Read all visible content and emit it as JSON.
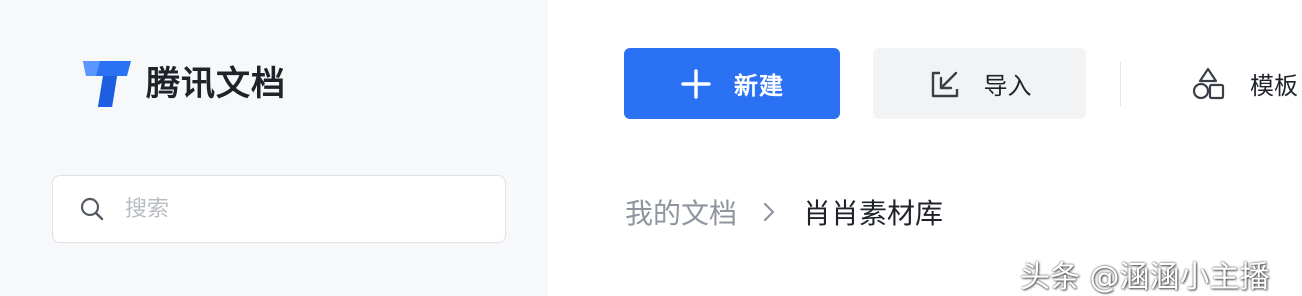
{
  "sidebar": {
    "logo": {
      "icon": "tencent-docs-logo-icon",
      "text": "腾讯文档"
    },
    "search": {
      "placeholder": "搜索",
      "value": "",
      "icon": "search-icon"
    }
  },
  "toolbar": {
    "new_button": {
      "label": "新建",
      "icon": "plus-icon"
    },
    "import_button": {
      "label": "导入",
      "icon": "import-icon"
    },
    "template_button": {
      "label": "模板",
      "icon": "template-shapes-icon"
    }
  },
  "breadcrumb": {
    "root": "我的文档",
    "separator_icon": "chevron-right-icon",
    "current": "肖肖素材库"
  },
  "watermark": {
    "text": "头条 @涵涵小主播"
  },
  "colors": {
    "accent": "#2a72f3",
    "sidebar_bg": "#f7f8fa",
    "import_bg": "#f2f3f5",
    "text_primary": "#1f2329",
    "text_secondary": "#8f959e",
    "placeholder": "#b8bcc4"
  }
}
